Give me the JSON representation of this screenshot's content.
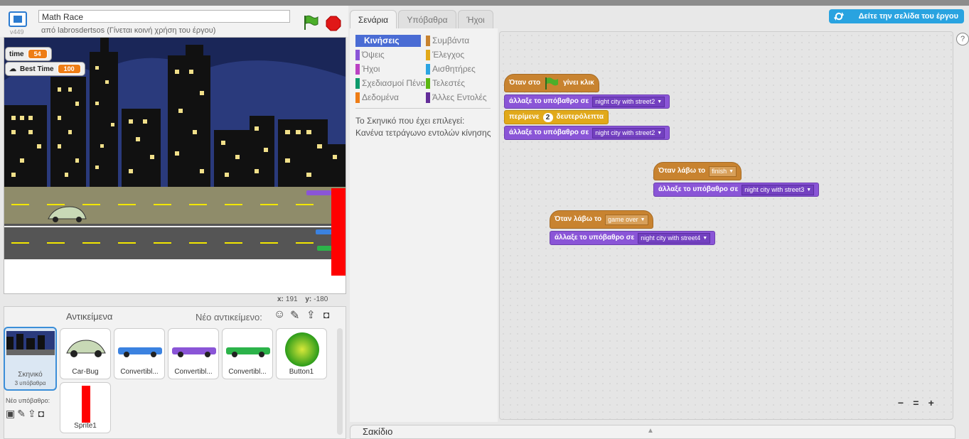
{
  "project": {
    "title": "Math Race",
    "version": "v449",
    "author_line": "από labrosdertsos (Γίνεται κοινή χρήση του έργου)"
  },
  "stage": {
    "monitors": [
      {
        "label": "time",
        "value": "54"
      },
      {
        "label": "Best Time",
        "value": "100"
      }
    ],
    "coords": {
      "x_label": "x:",
      "x": "191",
      "y_label": "y:",
      "y": "-180"
    }
  },
  "sprites_panel": {
    "title": "Αντικείμενα",
    "new_sprite_label": "Νέο αντικείμενο:",
    "stage_thumb": {
      "label": "Σκηνικό",
      "sub": "3 υπόβαθρα"
    },
    "new_backdrop_label": "Νέο υπόβαθρο:",
    "sprites": [
      {
        "name": "Car-Bug"
      },
      {
        "name": "Convertibl..."
      },
      {
        "name": "Convertibl..."
      },
      {
        "name": "Convertibl..."
      },
      {
        "name": "Button1"
      },
      {
        "name": "Sprite1"
      }
    ]
  },
  "tabs": [
    {
      "label": "Σενάρια",
      "active": true
    },
    {
      "label": "Υπόβαθρα",
      "active": false
    },
    {
      "label": "Ήχοι",
      "active": false
    }
  ],
  "share_button": "Δείτε την σελίδα του έργου",
  "palette": {
    "categories": [
      {
        "label": "Κινήσεις",
        "color": "#4a6cd4",
        "active": true
      },
      {
        "label": "Όψεις",
        "color": "#8a55d7"
      },
      {
        "label": "Ήχοι",
        "color": "#bb42c3"
      },
      {
        "label": "Σχεδιασμοί Πένα",
        "color": "#0e9a6c"
      },
      {
        "label": "Δεδομένα",
        "color": "#ee7d16"
      },
      {
        "label": "Συμβάντα",
        "color": "#c88330"
      },
      {
        "label": "Έλεγχος",
        "color": "#e1a91a"
      },
      {
        "label": "Αισθητήρες",
        "color": "#2ca5e2"
      },
      {
        "label": "Τελεστές",
        "color": "#5cb712"
      },
      {
        "label": "Άλλες Εντολές",
        "color": "#632d99"
      }
    ],
    "message_line1": "Το Σκηνικό που έχει επιλεγεί:",
    "message_line2": "Κανένα τετράγωνο εντολών κίνησης"
  },
  "scripts": {
    "s1_hat_pre": "Όταν στο",
    "s1_hat_post": "γίνει κλικ",
    "switch_label": "άλλαξε το υπόβαθρο σε",
    "s1_b1_value": "night city with street2",
    "wait_pre": "περίμενε",
    "wait_value": "2",
    "wait_post": "δευτερόλεπτα",
    "s1_b3_value": "night city with street2",
    "receive_label": "Όταν λάβω το",
    "s2_msg": "finish",
    "s2_value": "night city with street3",
    "s3_msg": "game over",
    "s3_value": "night city with street4"
  },
  "zoom": {
    "out": "−",
    "reset": "=",
    "in": "+"
  },
  "backpack": "Σακίδιο",
  "help": "?"
}
